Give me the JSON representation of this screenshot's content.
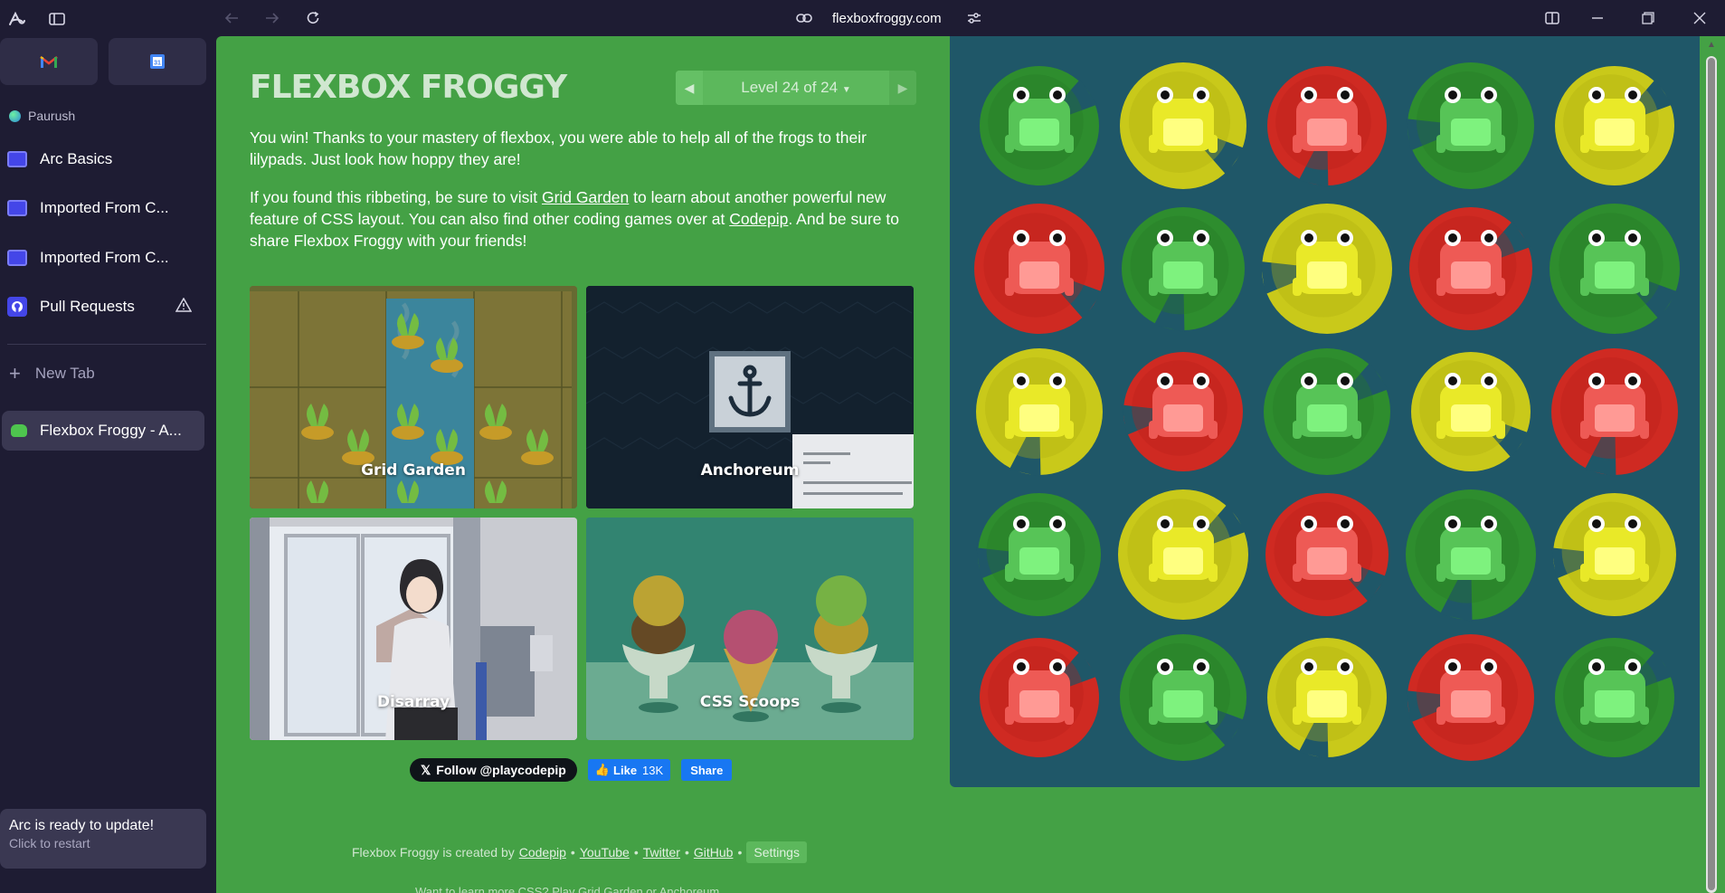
{
  "browser": {
    "url": "flexboxfroggy.com"
  },
  "sidebar": {
    "space": "Paurush",
    "items": [
      {
        "label": "Arc Basics"
      },
      {
        "label": "Imported From C..."
      },
      {
        "label": "Imported From C..."
      },
      {
        "label": "Pull Requests"
      }
    ],
    "new_tab": "New Tab",
    "active_tab": "Flexbox Froggy - A...",
    "update_title": "Arc is ready to update!",
    "update_sub": "Click to restart"
  },
  "page": {
    "title": "FLEXBOX FROGGY",
    "level": "Level 24 of 24",
    "p1": "You win! Thanks to your mastery of flexbox, you were able to help all of the frogs to their lilypads. Just look how hoppy they are!",
    "p2_a": "If you found this ribbeting, be sure to visit ",
    "p2_link1": "Grid Garden",
    "p2_b": " to learn about another powerful new feature of CSS layout. You can also find other coding games over at ",
    "p2_link2": "Codepip",
    "p2_c": ". And be sure to share Flexbox Froggy with your friends!",
    "tiles": [
      "Grid Garden",
      "Anchoreum",
      "Disarray",
      "CSS Scoops"
    ],
    "twitter": "Follow @playcodepip",
    "fb_like": "Like",
    "fb_count": "13K",
    "fb_share": "Share",
    "footer_prefix": "Flexbox Froggy is created by",
    "footer_links": [
      "Codepip",
      "YouTube",
      "Twitter",
      "GitHub"
    ],
    "footer_settings": "Settings",
    "footer2": "Want to learn more CSS? Play Grid Garden or Anchoreum."
  },
  "board": {
    "colors": {
      "green": "#44a145",
      "yellow": "#d4d41a",
      "red": "#d92c27"
    },
    "grid": [
      [
        "green",
        "yellow",
        "red",
        "green",
        "yellow"
      ],
      [
        "red",
        "green",
        "yellow",
        "red",
        "green"
      ],
      [
        "yellow",
        "red",
        "green",
        "yellow",
        "red"
      ],
      [
        "green",
        "yellow",
        "red",
        "green",
        "yellow"
      ],
      [
        "red",
        "green",
        "yellow",
        "red",
        "green"
      ]
    ]
  }
}
